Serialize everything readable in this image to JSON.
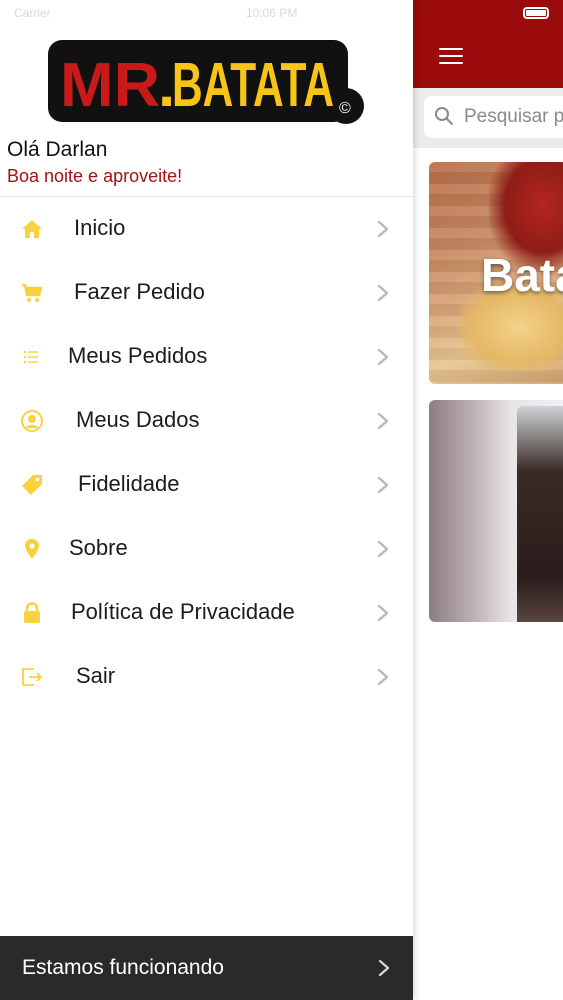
{
  "colors": {
    "brand_red": "#9b0b0b",
    "accent_red_text": "#a31212",
    "icon_yellow": "#f7d23e",
    "footer_bg": "#2a2a2a"
  },
  "status_bar": {
    "left": "Carrier",
    "time": "10:06 PM"
  },
  "drawer": {
    "logo_text": "MR.BATATA",
    "logo_mark": "©",
    "greeting": "Olá Darlan",
    "subgreeting": "Boa noite e aproveite!",
    "menu": [
      {
        "label": "Inicio",
        "icon": "home-icon"
      },
      {
        "label": "Fazer Pedido",
        "icon": "cart-icon"
      },
      {
        "label": "Meus Pedidos",
        "icon": "list-icon"
      },
      {
        "label": "Meus Dados",
        "icon": "user-icon"
      },
      {
        "label": "Fidelidade",
        "icon": "tag-icon"
      },
      {
        "label": "Sobre",
        "icon": "location-pin-icon"
      },
      {
        "label": "Política de Privacidade",
        "icon": "lock-icon"
      },
      {
        "label": "Sair",
        "icon": "logout-icon"
      }
    ],
    "footer": {
      "label": "Estamos funcionando"
    }
  },
  "main": {
    "search": {
      "placeholder": "Pesquisar p"
    },
    "cards": [
      {
        "title": "Bata"
      },
      {
        "title": ""
      }
    ]
  }
}
